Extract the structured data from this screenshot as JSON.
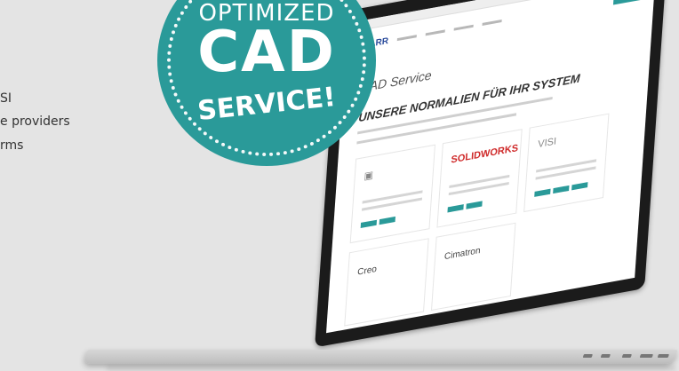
{
  "side_text": {
    "line1": "SI",
    "line2": "e providers",
    "line3": "rms"
  },
  "badge": {
    "top": "OPTIMIZED",
    "middle": "CAD",
    "bottom": "SERVICE!"
  },
  "website": {
    "logo": "KNARR",
    "page_heading": "CAD Service",
    "section_heading": "UNSERE NORMALIEN FÜR IHR SYSTEM",
    "cards": [
      {
        "label": ""
      },
      {
        "label": "SOLIDWORKS"
      },
      {
        "label": "VISI"
      }
    ],
    "cards_row2": [
      {
        "label": "Creo"
      },
      {
        "label": "Cimatron"
      }
    ]
  },
  "colors": {
    "teal": "#2a9a99",
    "background": "#e4e4e4"
  }
}
